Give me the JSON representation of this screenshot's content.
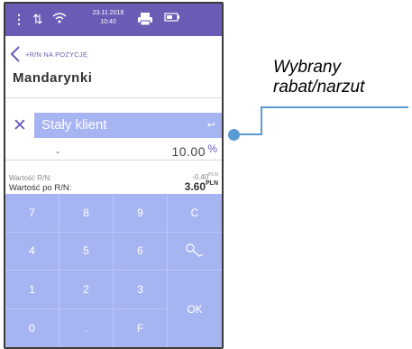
{
  "status_bar": {
    "menu_icon": "menu-dots-icon",
    "date": "23.11.2018",
    "time": "10:40",
    "icons": [
      "data-transfer-icon",
      "wifi-icon",
      "printer-icon",
      "battery-icon"
    ]
  },
  "header": {
    "subtitle": "+R/N NA POZYCJĘ",
    "title": "Mandarynki"
  },
  "discount": {
    "name": "Stały klient",
    "sign": "-",
    "value": "10.00",
    "unit": "%"
  },
  "summary": {
    "value_label": "Wartość R/N:",
    "value": "-0.40",
    "value_currency": "PLN",
    "after_label": "Wartość po R/N:",
    "after_value": "3.60",
    "after_currency": "PLN"
  },
  "keypad": {
    "k7": "7",
    "k8": "8",
    "k9": "9",
    "clear": "C",
    "k4": "4",
    "k5": "5",
    "k6": "6",
    "k1": "1",
    "k2": "2",
    "k3": "3",
    "ok": "OK",
    "k0": "0",
    "dot": ".",
    "f": "F"
  },
  "callout": {
    "line1": "Wybrany",
    "line2": "rabat/narzut"
  },
  "colors": {
    "accent": "#6a5bb5",
    "keypad": "#a7b4f2",
    "callout": "#5b9bd5"
  }
}
